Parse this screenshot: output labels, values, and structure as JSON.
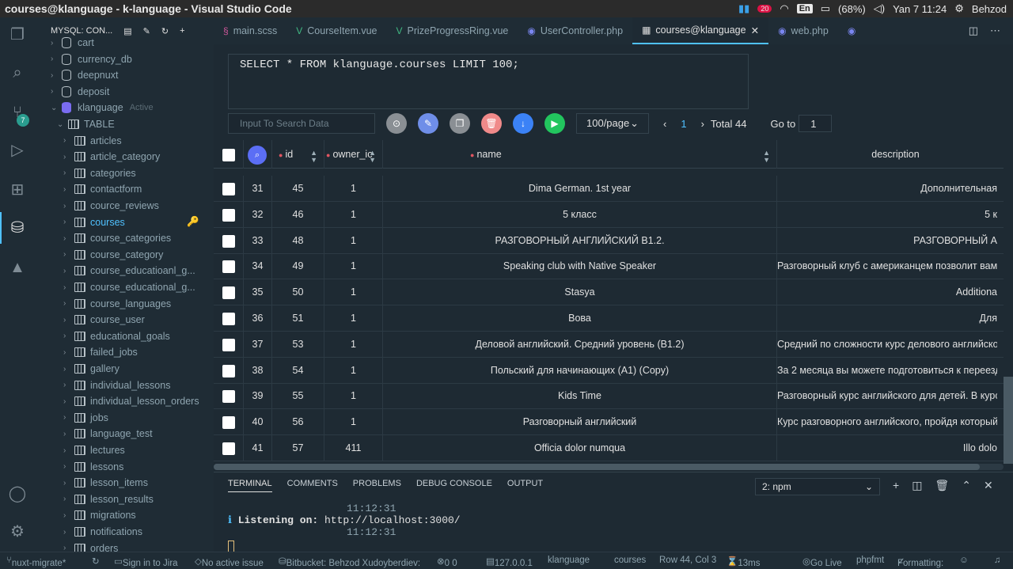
{
  "window": {
    "title": "courses@klanguage - k-language - Visual Studio Code"
  },
  "system": {
    "lang": "En",
    "battery": "(68%)",
    "clock": "Yan  7 11:24",
    "user": "Behzod",
    "notif_count": "20"
  },
  "sidebar": {
    "header": "MYSQL: CON...",
    "databases": [
      {
        "name": "cart"
      },
      {
        "name": "currency_db"
      },
      {
        "name": "deepnuxt"
      },
      {
        "name": "deposit"
      }
    ],
    "active_db": {
      "name": "klanguage",
      "tag": "Active"
    },
    "table_group": "TABLE",
    "tables": [
      "articles",
      "article_category",
      "categories",
      "contactform",
      "cource_reviews",
      "courses",
      "course_categories",
      "course_category",
      "course_educatioanl_g...",
      "course_educational_g...",
      "course_languages",
      "course_user",
      "educational_goals",
      "failed_jobs",
      "gallery",
      "individual_lessons",
      "individual_lesson_orders",
      "jobs",
      "language_test",
      "lectures",
      "lessons",
      "lesson_items",
      "lesson_results",
      "migrations",
      "notifications",
      "orders"
    ],
    "selected_table": "courses"
  },
  "tabs": [
    {
      "label": "main.scss"
    },
    {
      "label": "CourseItem.vue"
    },
    {
      "label": "PrizeProgressRing.vue"
    },
    {
      "label": "UserController.php"
    },
    {
      "label": "courses@klanguage",
      "active": true
    },
    {
      "label": "web.php"
    }
  ],
  "query": "SELECT * FROM klanguage.courses LIMIT 100;",
  "toolbar": {
    "search_placeholder": "Input To Search Data",
    "page_size": "100/page",
    "page": "1",
    "total": "Total 44",
    "goto_label": "Go to",
    "goto_value": "1"
  },
  "table": {
    "columns": [
      "id",
      "owner_ic",
      "name",
      "description"
    ],
    "rows": [
      {
        "n": "31",
        "id": "45",
        "owner": "1",
        "name": "Dima German. 1st year",
        "desc": "Дополнительная"
      },
      {
        "n": "32",
        "id": "46",
        "owner": "1",
        "name": "5 класс",
        "desc": "5 к"
      },
      {
        "n": "33",
        "id": "48",
        "owner": "1",
        "name": "РАЗГОВОРНЫЙ АНГЛИЙСКИЙ В1.2.",
        "desc": "РАЗГОВОРНЫЙ А"
      },
      {
        "n": "34",
        "id": "49",
        "owner": "1",
        "name": "Speaking club with Native Speaker",
        "desc": "Разговорный клуб с американцем позволит вам"
      },
      {
        "n": "35",
        "id": "50",
        "owner": "1",
        "name": "Stasya",
        "desc": "Additiona"
      },
      {
        "n": "36",
        "id": "51",
        "owner": "1",
        "name": "Вова",
        "desc": "Для"
      },
      {
        "n": "37",
        "id": "53",
        "owner": "1",
        "name": "Деловой английский. Средний уровень (В1.2)",
        "desc": "Средний по сложности курс делового английског"
      },
      {
        "n": "38",
        "id": "54",
        "owner": "1",
        "name": "Польский для начинающих (А1) (Copy)",
        "desc": "За 2 месяца вы можете подготовиться к переезд"
      },
      {
        "n": "39",
        "id": "55",
        "owner": "1",
        "name": "Kids Time",
        "desc": "Разговорный курс английского для детей. В курс"
      },
      {
        "n": "40",
        "id": "56",
        "owner": "1",
        "name": "Разговорный английский",
        "desc": "Курс разговорного английского, пройдя который,"
      },
      {
        "n": "41",
        "id": "57",
        "owner": "411",
        "name": "Officia dolor numqua",
        "desc": "Illo dolo"
      }
    ]
  },
  "panel": {
    "tabs": [
      "TERMINAL",
      "COMMENTS",
      "PROBLEMS",
      "DEBUG CONSOLE",
      "OUTPUT"
    ],
    "terminal_select": "2: npm",
    "lines": [
      {
        "time": "11:12:31"
      },
      {
        "prefix": "ℹ ",
        "bold": "Listening on:",
        "text": " http://localhost:3000/"
      },
      {
        "time": "11:12:31"
      }
    ]
  },
  "status": {
    "branch": "nuxt-migrate*",
    "jira": "Sign in to Jira",
    "issue": "No active issue",
    "bitbucket": "Bitbucket: Behzod Xudoyberdiev:",
    "problems": "0  0",
    "host": "127.0.0.1",
    "db": "klanguage",
    "table": "courses",
    "pos": "Row 44, Col 3",
    "time": "13ms",
    "golive": "Go Live",
    "phpfmt": "phpfmt",
    "formatting": "Formatting: "
  }
}
